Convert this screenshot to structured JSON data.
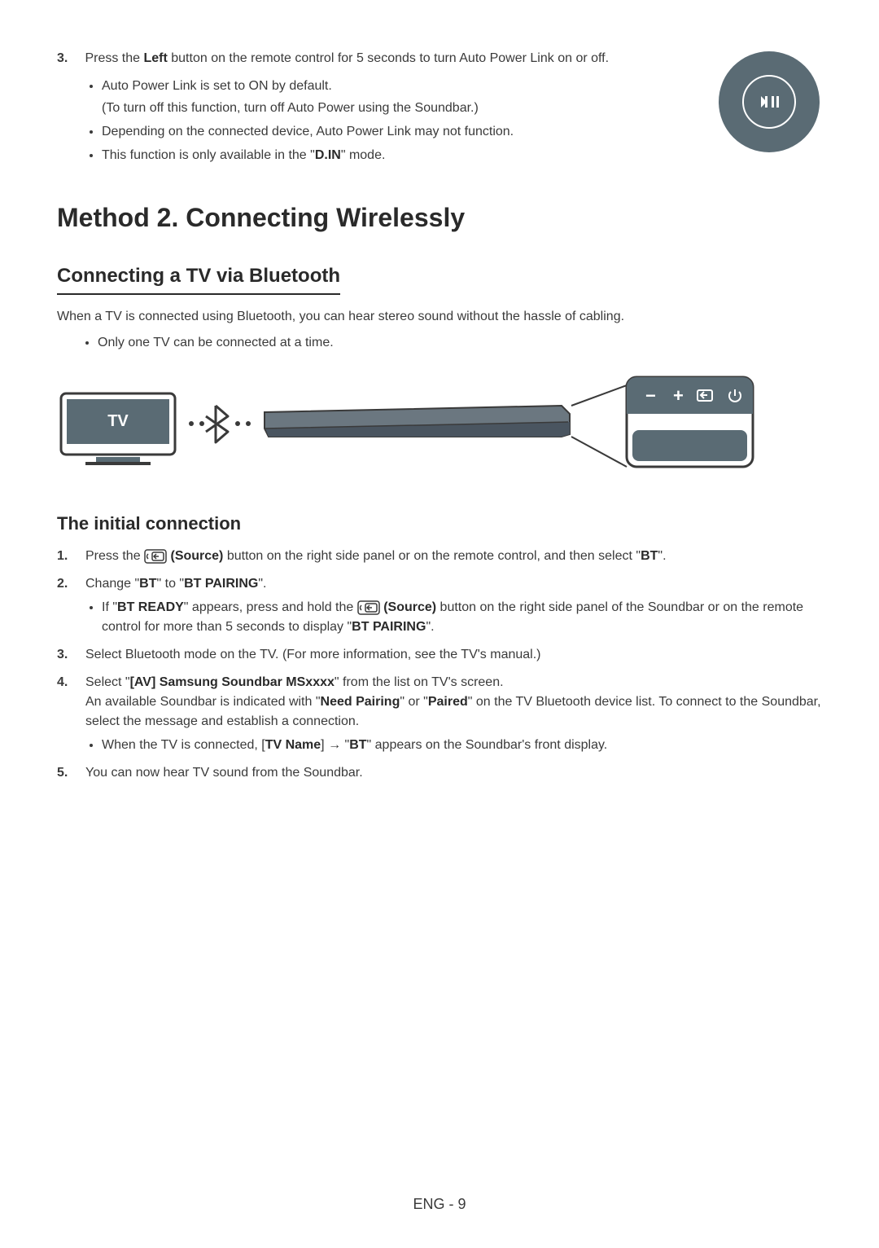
{
  "step3": {
    "num": "3.",
    "text_pre": "Press the ",
    "bold_left": "Left",
    "text_post": " button on the remote control for 5 seconds to turn Auto Power Link on or off.",
    "bullets": {
      "b1_line1": "Auto Power Link is set to ON by default.",
      "b1_line2": "(To turn off this function, turn off Auto Power using the Soundbar.)",
      "b2": "Depending on the connected device, Auto Power Link may not function.",
      "b3_pre": "This function is only available in the \"",
      "b3_bold": "D.IN",
      "b3_post": "\" mode."
    }
  },
  "method2_heading": "Method 2. Connecting Wirelessly",
  "bluetooth_heading": "Connecting a TV via Bluetooth",
  "bluetooth_desc": "When a TV is connected using Bluetooth, you can hear stereo sound without the hassle of cabling.",
  "bluetooth_note": "Only one TV can be connected at a time.",
  "tv_label": "TV",
  "initial_heading": "The initial connection",
  "steps": {
    "s1": {
      "pre": "Press the ",
      "source_label": "(Source)",
      "mid": " button on the right side panel or on the remote control, and then select \"",
      "bt": "BT",
      "post": "\"."
    },
    "s2": {
      "pre": "Change \"",
      "bt": "BT",
      "mid": "\" to \"",
      "bt_pairing": "BT PAIRING",
      "post": "\".",
      "sub": {
        "pre": "If \"",
        "bt_ready": "BT READY",
        "mid1": "\" appears, press and hold the ",
        "source_label": "(Source)",
        "mid2": " button on the right side panel of the Soundbar or on the remote control for more than 5 seconds to display \"",
        "bt_pairing": "BT PAIRING",
        "post": "\"."
      }
    },
    "s3": "Select Bluetooth mode on the TV. (For more information, see the TV's manual.)",
    "s4": {
      "pre": "Select \"",
      "av_bold": "[AV] Samsung Soundbar MSxxxx",
      "mid1": "\" from the list on TV's screen.",
      "line2_pre": "An available Soundbar is indicated with \"",
      "need_pairing": "Need Pairing",
      "line2_mid": "\" or \"",
      "paired": "Paired",
      "line2_post": "\" on the TV Bluetooth device list. To connect to the Soundbar, select the message and establish a connection.",
      "sub": {
        "pre": "When the TV is connected, [",
        "tv_name": "TV Name",
        "mid": "] → \"",
        "bt": "BT",
        "post": "\" appears on the Soundbar's front display."
      }
    },
    "s5": "You can now hear TV sound from the Soundbar."
  },
  "footer": "ENG - 9"
}
